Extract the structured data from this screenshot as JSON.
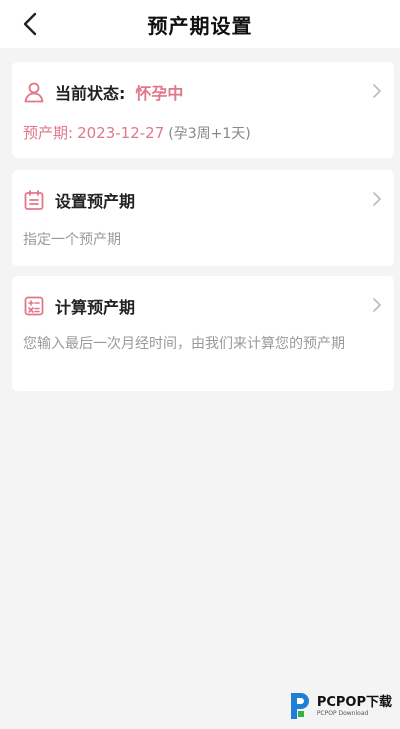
{
  "header": {
    "title": "预产期设置"
  },
  "status_card": {
    "label": "当前状态:",
    "status": "怀孕中",
    "due_label": "预产期:",
    "due_date": "2023-12-27",
    "gestation": "(孕3周+1天)"
  },
  "set_card": {
    "title": "设置预产期",
    "desc": "指定一个预产期"
  },
  "calc_card": {
    "title": "计算预产期",
    "desc": "您输入最后一次月经时间，由我们来计算您的预产期"
  },
  "watermark": {
    "main": "PCPOP下载",
    "sub": "PCPOP Download"
  },
  "colors": {
    "accent": "#e2778a",
    "background": "#f4f4f4",
    "card": "#ffffff"
  },
  "icons": [
    "back-arrow-icon",
    "person-icon",
    "calendar-icon",
    "calculator-icon",
    "chevron-right-icon"
  ]
}
